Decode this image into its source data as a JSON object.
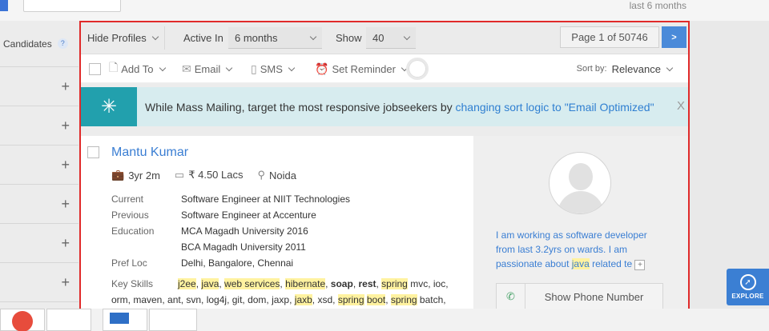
{
  "top": {
    "right_text": "last 6 months"
  },
  "sidebar": {
    "candidates_label": "Candidates",
    "help_glyph": "?",
    "expand_glyph": "+",
    "rows": 6
  },
  "toolbar": {
    "hide_profiles": "Hide Profiles",
    "active_in_label": "Active In",
    "active_in_value": "6 months",
    "show_label": "Show",
    "show_value": "40",
    "pager_text": "Page 1 of 50746",
    "next_glyph": ">"
  },
  "actions": {
    "add_to": "Add To",
    "email": "Email",
    "sms": "SMS",
    "set_reminder": "Set Reminder",
    "sort_by_label": "Sort by:",
    "sort_by_value": "Relevance"
  },
  "banner": {
    "text": "While Mass Mailing, target the most responsive jobseekers by ",
    "link": "changing sort logic to \"Email Optimized\"",
    "close": "X"
  },
  "candidate": {
    "name": "Mantu Kumar",
    "experience": "3yr 2m",
    "salary": "₹ 4.50 Lacs",
    "location": "Noida",
    "details": [
      {
        "label": "Current",
        "value": "Software Engineer at NIIT Technologies"
      },
      {
        "label": "Previous",
        "value": "Software Engineer at Accenture"
      },
      {
        "label": "Education",
        "value": "MCA Magadh University 2016"
      },
      {
        "label": "",
        "value": "BCA Magadh University 2011"
      },
      {
        "label": "Pref Loc",
        "value": "Delhi, Bangalore, Chennai"
      }
    ],
    "skills_label": "Key Skills",
    "skills": [
      {
        "t": "j2ee",
        "s": "hl"
      },
      {
        "t": ", ",
        "s": ""
      },
      {
        "t": "java",
        "s": "hl"
      },
      {
        "t": ", ",
        "s": ""
      },
      {
        "t": "web services",
        "s": "hl"
      },
      {
        "t": ", ",
        "s": ""
      },
      {
        "t": "hibernate",
        "s": "hl"
      },
      {
        "t": ", ",
        "s": ""
      },
      {
        "t": "soap",
        "s": "b"
      },
      {
        "t": ", ",
        "s": ""
      },
      {
        "t": "rest",
        "s": "b"
      },
      {
        "t": ", ",
        "s": ""
      },
      {
        "t": "spring",
        "s": "hl"
      },
      {
        "t": " mvc, ioc, orm, maven, ant, svn, log4j, git, dom, jaxp, ",
        "s": ""
      },
      {
        "t": "jaxb",
        "s": "hl"
      },
      {
        "t": ", xsd, ",
        "s": ""
      },
      {
        "t": "spring",
        "s": "hl"
      },
      {
        "t": " ",
        "s": ""
      },
      {
        "t": "boot",
        "s": "hl"
      },
      {
        "t": ", ",
        "s": ""
      },
      {
        "t": "spring",
        "s": "hl"
      },
      {
        "t": " batch,",
        "s": ""
      }
    ],
    "summary_before": "I am working as software developer from last 3.2yrs on wards. I am passionate about ",
    "summary_highlight": "java",
    "summary_after": " related te",
    "summary_more": "+",
    "show_phone": "Show Phone Number"
  },
  "explore": {
    "label": "EXPLORE"
  },
  "colors": {
    "accent": "#4a8ad9",
    "highlight": "#fff2a0",
    "border": "#e02a2a",
    "banner": "#22a0ad"
  }
}
